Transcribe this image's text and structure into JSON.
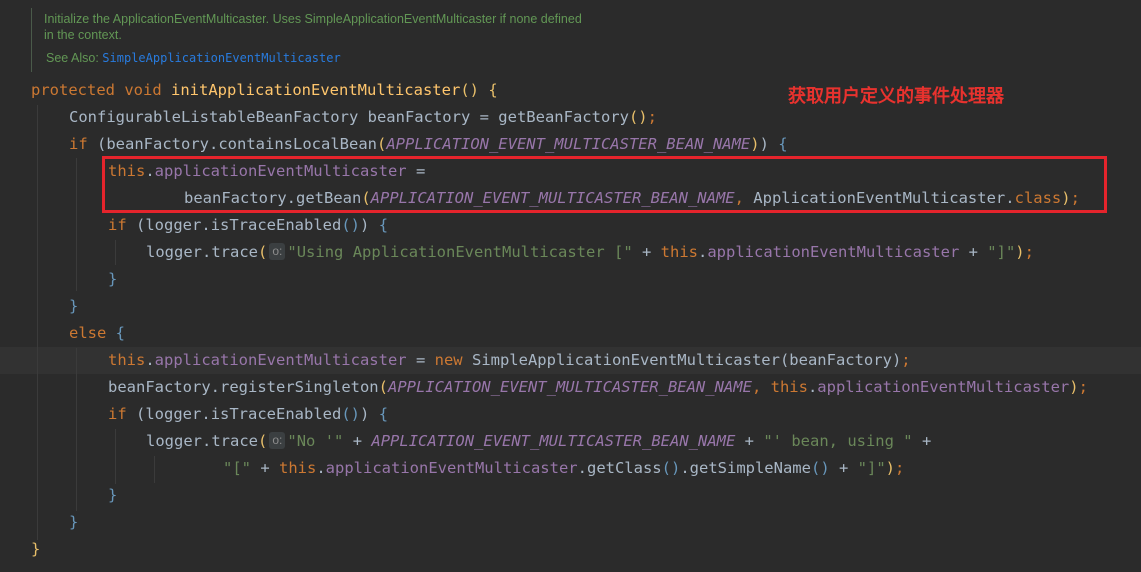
{
  "doc": {
    "line1": "Initialize the ApplicationEventMulticaster. Uses SimpleApplicationEventMulticaster if none defined",
    "line2": "in the context.",
    "see_also_label": "See Also: ",
    "see_also_link": "SimpleApplicationEventMulticaster"
  },
  "code": {
    "kw_protected": "protected",
    "kw_void": "void",
    "method_name": "initApplicationEventMulticaster",
    "type_clbf": "ConfigurableListableBeanFactory",
    "var_beanFactory": "beanFactory",
    "call_getBeanFactory": "getBeanFactory",
    "kw_if": "if",
    "kw_else": "else",
    "kw_this": "this",
    "kw_new": "new",
    "kw_class": "class",
    "call_containsLocalBean": "containsLocalBean",
    "const_name": "APPLICATION_EVENT_MULTICASTER_BEAN_NAME",
    "field_multicaster": "applicationEventMulticaster",
    "call_getBean": "getBean",
    "type_aem": "ApplicationEventMulticaster",
    "var_logger": "logger",
    "call_isTraceEnabled": "isTraceEnabled",
    "call_trace": "trace",
    "hint_o": "o:",
    "str_using": "\"Using ApplicationEventMulticaster [\"",
    "str_close": "\"]\"",
    "type_saem": "SimpleApplicationEventMulticaster",
    "call_registerSingleton": "registerSingleton",
    "str_no": "\"No '\"",
    "str_bean_using": "\"' bean, using \"",
    "str_open": "\"[\"",
    "call_getClass": "getClass",
    "call_getSimpleName": "getSimpleName"
  },
  "annotation": {
    "text": "获取用户定义的事件处理器",
    "color": "#e8322e"
  },
  "colors": {
    "background": "#2b2b2b",
    "keyword": "#cc7832",
    "method": "#ffc66d",
    "field": "#9876aa",
    "string": "#6a8759",
    "comment": "#629755",
    "highlight_border": "#e5242c"
  }
}
